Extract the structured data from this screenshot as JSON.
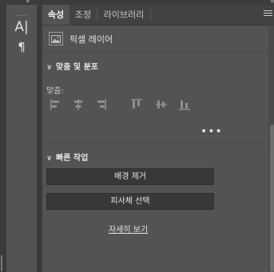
{
  "collapse_left": "«",
  "collapse_right": "«",
  "tools": {
    "character": "A|",
    "paragraph": "¶"
  },
  "tabs": [
    {
      "label": "속성",
      "active": true
    },
    {
      "label": "조정",
      "active": false
    },
    {
      "label": "라이브러리",
      "active": false
    }
  ],
  "layer": {
    "type_label": "픽셀 레이어"
  },
  "align_section": {
    "title": "맞춤 및 분포",
    "align_label": "맞춤:",
    "icons": [
      "align-left-edges-icon",
      "align-horizontal-centers-icon",
      "align-right-edges-icon",
      "align-top-edges-icon",
      "align-vertical-centers-icon",
      "align-bottom-edges-icon"
    ],
    "more_label": "•••"
  },
  "quick_actions": {
    "title": "빠른 작업",
    "remove_bg_label": "배경 제거",
    "select_subject_label": "피사체 선택",
    "view_more_label": "자세히 보기"
  },
  "colors": {
    "panel_bg": "#535353",
    "tab_bar_bg": "#424242",
    "button_bg": "#383838"
  }
}
